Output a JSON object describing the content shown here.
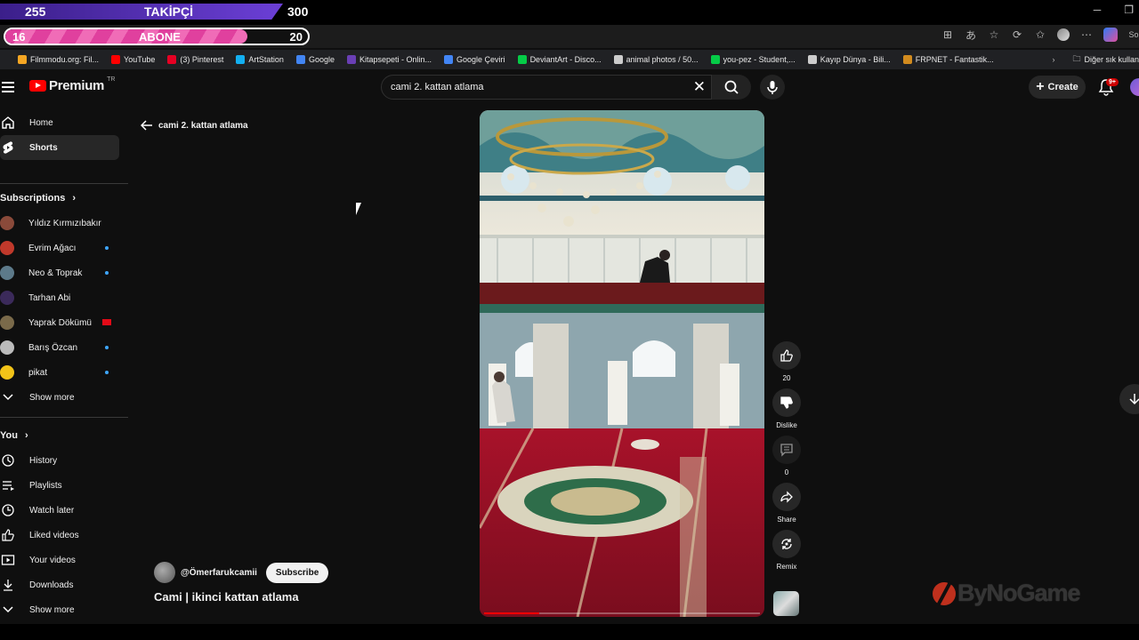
{
  "overlay": {
    "follower_current": "255",
    "follower_label": "TAKİPÇİ",
    "follower_target": "300",
    "subscriber_current": "16",
    "subscriber_label": "ABONE",
    "subscriber_target": "20",
    "subscriber_progress": 0.8
  },
  "bookmarks": [
    {
      "label": "Filmmodu.org: Fil...",
      "color": "#f5a623"
    },
    {
      "label": "YouTube",
      "color": "#ff0000"
    },
    {
      "label": "(3) Pinterest",
      "color": "#e60023"
    },
    {
      "label": "ArtStation",
      "color": "#13aff0"
    },
    {
      "label": "Google",
      "color": "#4285f4"
    },
    {
      "label": "Kitapsepeti - Onlin...",
      "color": "#6a3fb5"
    },
    {
      "label": "Google Çeviri",
      "color": "#4285f4"
    },
    {
      "label": "DeviantArt - Disco...",
      "color": "#05cc47"
    },
    {
      "label": "animal photos / 50...",
      "color": "#cccccc"
    },
    {
      "label": "you-pez - Student,...",
      "color": "#05cc47"
    },
    {
      "label": "Kayıp Dünya - Bili...",
      "color": "#cccccc"
    },
    {
      "label": "FRPNET - Fantastik...",
      "color": "#d28b1e"
    }
  ],
  "bookmarks_more": "Diğer sık kullan",
  "browser_profile_text": "So",
  "header": {
    "logo_text": "Premium",
    "logo_region": "TR",
    "search_value": "cami 2. kattan atlama",
    "create_label": "Create",
    "notification_badge": "9+"
  },
  "sidebar": {
    "main": [
      {
        "label": "Home",
        "icon": "home-icon"
      },
      {
        "label": "Shorts",
        "icon": "shorts-icon"
      }
    ],
    "subscriptions_title": "Subscriptions",
    "subscriptions": [
      {
        "label": "Yıldız Kırmızıbakır",
        "avatar": "#8a4a3a",
        "mark": "none"
      },
      {
        "label": "Evrim Ağacı",
        "avatar": "#c0392b",
        "mark": "dot"
      },
      {
        "label": "Neo & Toprak",
        "avatar": "#5d7a8a",
        "mark": "dot"
      },
      {
        "label": "Tarhan Abi",
        "avatar": "#3b2a5a",
        "mark": "none"
      },
      {
        "label": "Yaprak Dökümü",
        "avatar": "#7a6a4a",
        "mark": "flag"
      },
      {
        "label": "Barış Özcan",
        "avatar": "#bbbbbb",
        "mark": "dot"
      },
      {
        "label": "pikat",
        "avatar": "#f2c318",
        "mark": "dot"
      }
    ],
    "show_more_1": "Show more",
    "you_title": "You",
    "you_items": [
      {
        "label": "History",
        "icon": "history-icon"
      },
      {
        "label": "Playlists",
        "icon": "playlists-icon"
      },
      {
        "label": "Watch later",
        "icon": "watch-later-icon"
      },
      {
        "label": "Liked videos",
        "icon": "liked-icon"
      },
      {
        "label": "Your videos",
        "icon": "your-videos-icon"
      },
      {
        "label": "Downloads",
        "icon": "downloads-icon"
      }
    ],
    "show_more_2": "Show more"
  },
  "main": {
    "back_label": "cami 2. kattan atlama",
    "channel": "@Ömerfarukcamii",
    "subscribe_label": "Subscribe",
    "video_title": "Cami | ikinci kattan atlama",
    "progress": 0.2,
    "actions": {
      "like_count": "20",
      "dislike_label": "Dislike",
      "comments_count": "0",
      "share_label": "Share",
      "remix_label": "Remix"
    }
  },
  "watermark": "ByNoGame"
}
